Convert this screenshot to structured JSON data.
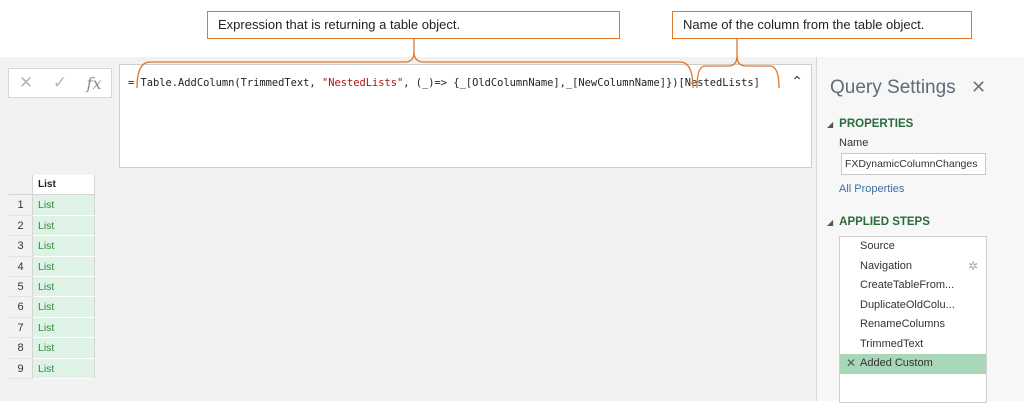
{
  "callouts": {
    "expression": "Expression that is returning a table object.",
    "column_name": "Name of the column from the table object."
  },
  "formula_bar": {
    "cancel_icon": "close-icon",
    "commit_icon": "check-icon",
    "fx_label": "fx",
    "prefix": "= Table.AddColumn(TrimmedText, ",
    "string_literal": "\"NestedLists\"",
    "suffix": ", (_)=> {_[OldColumnName],_[NewColumnName]})[NestedLists]",
    "collapse_icon": "chevron-up-icon"
  },
  "grid": {
    "column_header": "List",
    "rows": [
      {
        "num": "1",
        "value": "List"
      },
      {
        "num": "2",
        "value": "List"
      },
      {
        "num": "3",
        "value": "List"
      },
      {
        "num": "4",
        "value": "List"
      },
      {
        "num": "5",
        "value": "List"
      },
      {
        "num": "6",
        "value": "List"
      },
      {
        "num": "7",
        "value": "List"
      },
      {
        "num": "8",
        "value": "List"
      },
      {
        "num": "9",
        "value": "List"
      }
    ]
  },
  "query_settings": {
    "title": "Query Settings",
    "close_glyph": "✕",
    "properties_heading": "PROPERTIES",
    "name_label": "Name",
    "name_value": "FXDynamicColumnChanges",
    "all_properties_link": "All Properties",
    "applied_steps_heading": "APPLIED STEPS",
    "steps": [
      "Source",
      "Navigation",
      "CreateTableFrom...",
      "DuplicateOldColu...",
      "RenameColumns",
      "TrimmedText",
      "Added Custom"
    ],
    "active_step": "Added Custom"
  },
  "colors": {
    "accent_orange": "#e0782a",
    "cell_green": "#dff2e6",
    "active_step": "#a8d7b7",
    "heading_green": "#2a6b3c"
  }
}
